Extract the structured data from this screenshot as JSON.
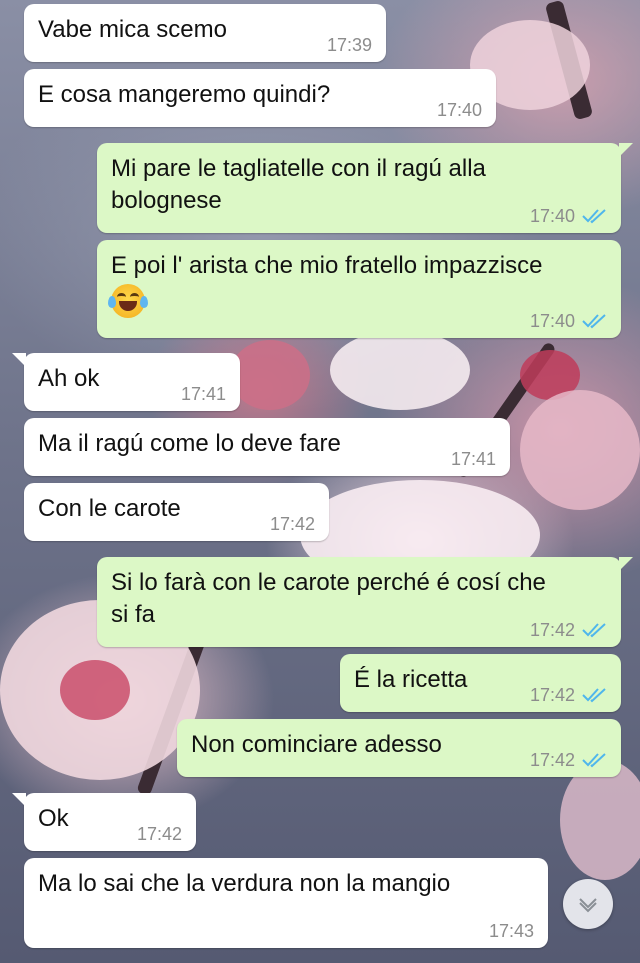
{
  "messages": [
    {
      "id": "m1",
      "direction": "in",
      "text": "Vabe mica scemo",
      "time": "17:39"
    },
    {
      "id": "m2",
      "direction": "in",
      "text": "E cosa mangeremo quindi?",
      "time": "17:40"
    },
    {
      "id": "m3",
      "direction": "out",
      "lines": [
        "Mi pare le tagliatelle con il ragú alla",
        "bolognese"
      ],
      "time": "17:40",
      "status": "read"
    },
    {
      "id": "m4",
      "direction": "out",
      "lines": [
        "E poi l' arista che mio fratello impazzisce"
      ],
      "emoji": "face-with-tears-of-joy",
      "time": "17:40",
      "status": "read"
    },
    {
      "id": "m5",
      "direction": "in",
      "text": "Ah ok",
      "time": "17:41"
    },
    {
      "id": "m6",
      "direction": "in",
      "text": "Ma il ragú come lo deve fare",
      "time": "17:41"
    },
    {
      "id": "m7",
      "direction": "in",
      "text": "Con le carote",
      "time": "17:42"
    },
    {
      "id": "m8",
      "direction": "out",
      "lines": [
        "Si lo farà con le carote perché é cosí che",
        "si fa"
      ],
      "time": "17:42",
      "status": "read"
    },
    {
      "id": "m9",
      "direction": "out",
      "text": "É la ricetta",
      "time": "17:42",
      "status": "read"
    },
    {
      "id": "m10",
      "direction": "out",
      "text": "Non cominciare adesso",
      "time": "17:42",
      "status": "read"
    },
    {
      "id": "m11",
      "direction": "in",
      "text": "Ok",
      "time": "17:42"
    },
    {
      "id": "m12",
      "direction": "in",
      "text": "Ma lo sai che la verdura non la mangio",
      "time": "17:43"
    }
  ],
  "scroll_button": {
    "icon": "chevron-down-icon"
  },
  "colors": {
    "incoming_bubble": "#ffffff",
    "outgoing_bubble": "#dcf8c6",
    "read_ticks": "#4fb6ec",
    "timestamp": "#8c8c8c"
  }
}
